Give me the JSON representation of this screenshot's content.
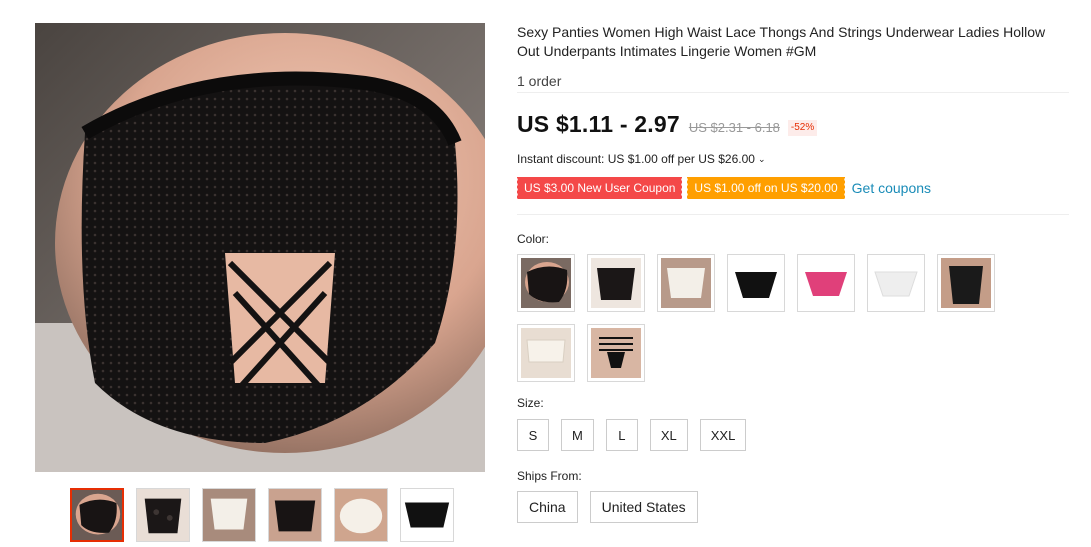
{
  "product": {
    "title": "Sexy Panties Women High Waist Lace Thongs And Strings Underwear Ladies Hollow Out Underpants Intimates Lingerie Women #GM",
    "orders": "1 order"
  },
  "price": {
    "current": "US $1.11 - 2.97",
    "original": "US $2.31 - 6.18",
    "discount": "-52%",
    "instant_discount": "Instant discount: US $1.00 off per US $26.00",
    "instant_discount_icon": "chevron-down-icon"
  },
  "coupons": {
    "items": [
      {
        "label": "US $3.00 New User Coupon",
        "color": "#f44848"
      },
      {
        "label": "US $1.00 off on US $20.00",
        "color": "#ff9f00"
      }
    ],
    "get_label": "Get coupons"
  },
  "color": {
    "label": "Color:",
    "swatches": [
      {
        "name": "black-lace-back",
        "color": "#1a1a1a"
      },
      {
        "name": "black-lace-front",
        "color": "#1a1a1a"
      },
      {
        "name": "white-lace-back",
        "color": "#f0ece6"
      },
      {
        "name": "black-brief",
        "color": "#111111"
      },
      {
        "name": "rose-pink",
        "color": "#e0407a"
      },
      {
        "name": "white-brief",
        "color": "#f5f5f5"
      },
      {
        "name": "black-high-waist",
        "color": "#1a1a1a"
      },
      {
        "name": "white-boyshort",
        "color": "#efe9e0"
      },
      {
        "name": "black-strappy",
        "color": "#111111"
      }
    ]
  },
  "size": {
    "label": "Size:",
    "options": [
      "S",
      "M",
      "L",
      "XL",
      "XXL"
    ]
  },
  "ships": {
    "label": "Ships From:",
    "options": [
      "China",
      "United States"
    ]
  },
  "gallery": {
    "thumbnail_count": 6,
    "active_index": 0
  },
  "colors": {
    "accent_red": "#e62e04",
    "link_blue": "#1a8cb8"
  }
}
